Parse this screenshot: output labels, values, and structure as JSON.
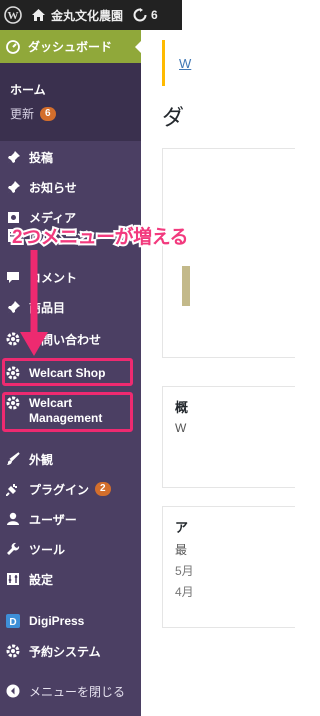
{
  "adminbar": {
    "site_name": "金丸文化農園",
    "updates_count": "6"
  },
  "sidebar": {
    "dashboard": "ダッシュボード",
    "home": "ホーム",
    "updates": "更新",
    "updates_badge": "6",
    "items": [
      {
        "label": "投稿",
        "icon": "pin-icon"
      },
      {
        "label": "お知らせ",
        "icon": "pin-icon"
      },
      {
        "label": "メディア",
        "icon": "media-icon"
      },
      {
        "label": "固定ページ",
        "icon": "page-icon"
      },
      {
        "label": "コメント",
        "icon": "comment-icon"
      },
      {
        "label": "商品目",
        "icon": "pin-icon"
      },
      {
        "label": "お問い合わせ",
        "icon": "gear-icon"
      },
      {
        "label": "Welcart Shop",
        "icon": "gear-icon"
      },
      {
        "label": "Welcart Management",
        "icon": "gear-icon"
      },
      {
        "label": "外観",
        "icon": "brush-icon"
      },
      {
        "label": "プラグイン",
        "icon": "plug-icon",
        "badge": "2"
      },
      {
        "label": "ユーザー",
        "icon": "user-icon"
      },
      {
        "label": "ツール",
        "icon": "wrench-icon"
      },
      {
        "label": "設定",
        "icon": "settings-icon"
      },
      {
        "label": "DigiPress",
        "icon": "digipress-icon"
      },
      {
        "label": "予約システム",
        "icon": "gear-icon"
      },
      {
        "label": "メニューを閉じる",
        "icon": "collapse-icon"
      }
    ]
  },
  "main": {
    "notice_link": "W",
    "title": "ダ",
    "panel_b_header": "概",
    "panel_b_text": "W",
    "panel_c_header": "ア",
    "panel_c_text": "最",
    "panel_c_date1": "5月",
    "panel_c_date2": "4月"
  },
  "annotation": {
    "text": "2つメニューが増える",
    "color": "#f23a7e"
  }
}
